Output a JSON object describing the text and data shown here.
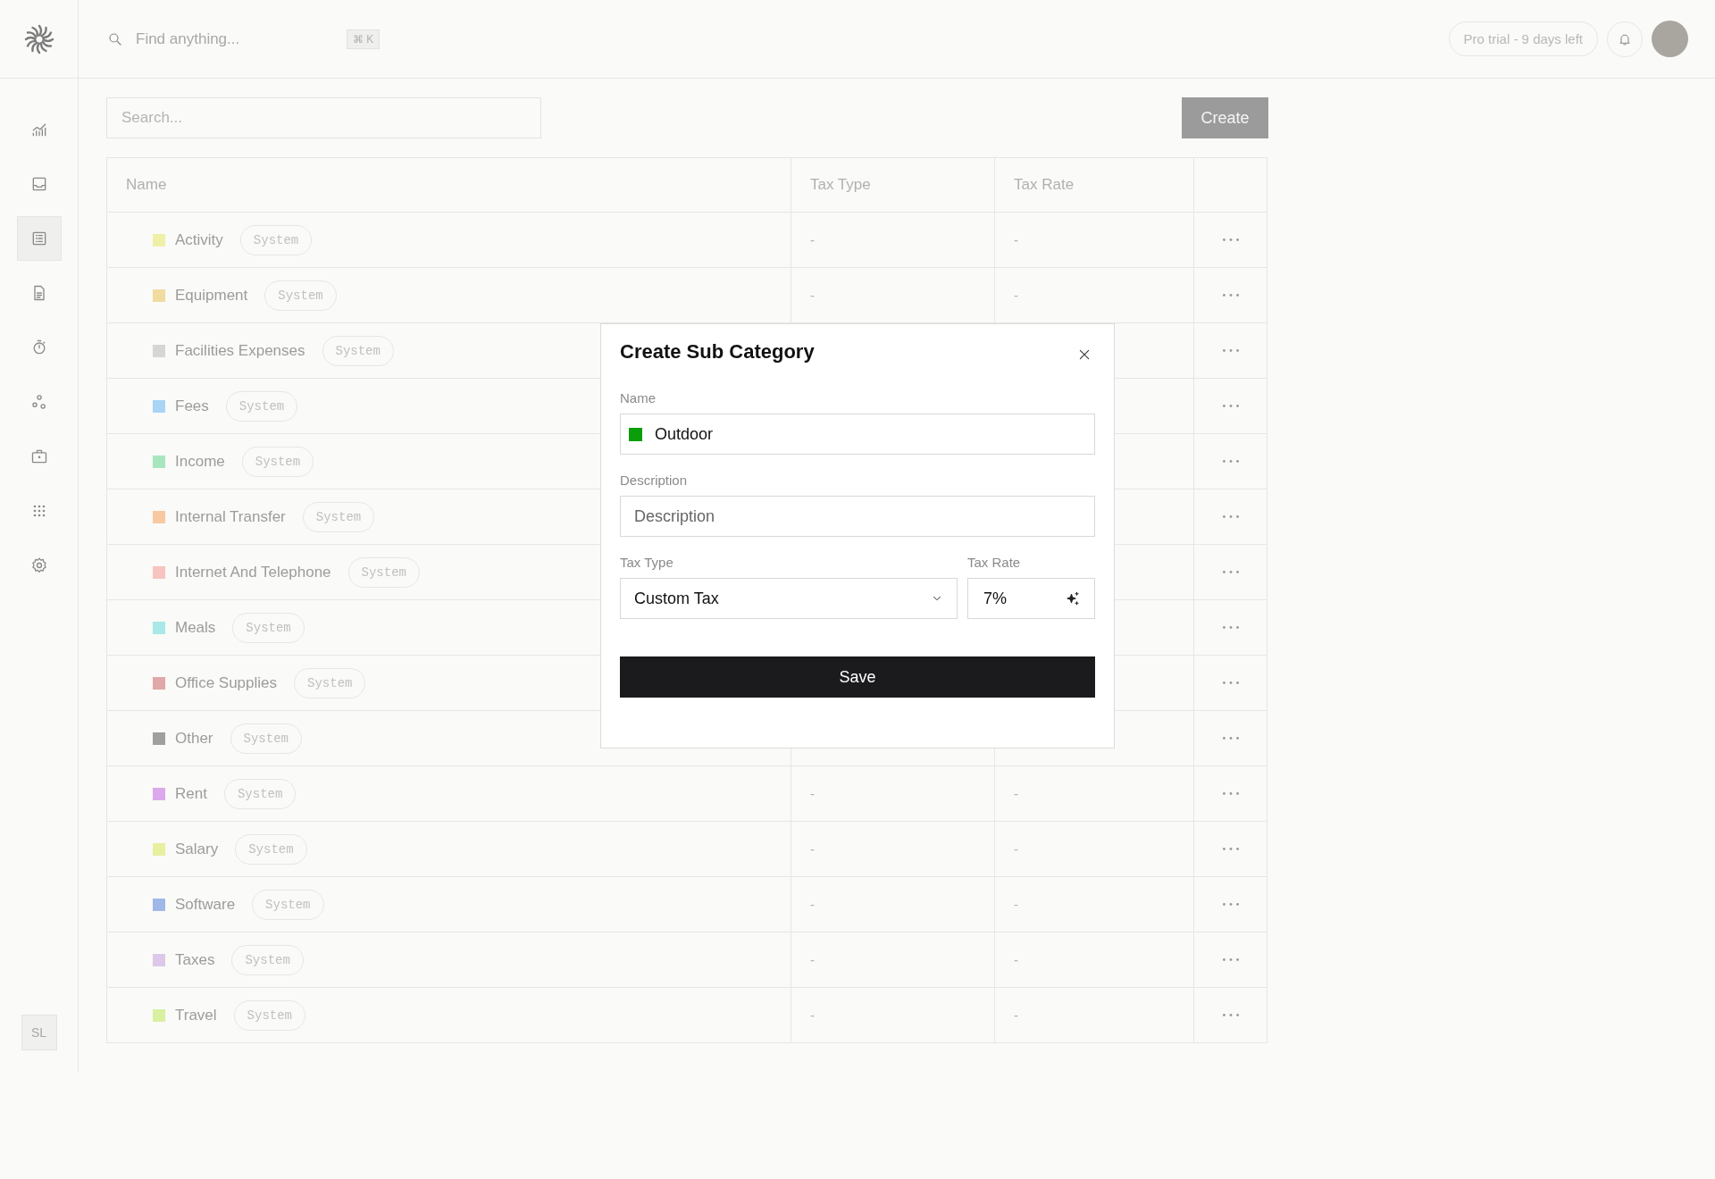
{
  "topbar": {
    "search_placeholder": "Find anything...",
    "shortcut": "⌘ K",
    "trial_badge": "Pro trial - 9 days left"
  },
  "sidebar": {
    "items": [
      {
        "kind": "chart",
        "selected": false
      },
      {
        "kind": "inbox",
        "selected": false
      },
      {
        "kind": "list",
        "selected": true
      },
      {
        "kind": "document",
        "selected": false
      },
      {
        "kind": "timer",
        "selected": false
      },
      {
        "kind": "circles",
        "selected": false
      },
      {
        "kind": "briefcase",
        "selected": false
      },
      {
        "kind": "grid",
        "selected": false
      },
      {
        "kind": "gear",
        "selected": false
      }
    ],
    "user_initials": "SL"
  },
  "toolbar": {
    "search_placeholder": "Search...",
    "create_button": "Create"
  },
  "table": {
    "columns": [
      "Name",
      "Tax Type",
      "Tax Rate"
    ],
    "rows": [
      {
        "name": "Activity",
        "color": "#eef0a8",
        "tag": "System",
        "tax_type": "-",
        "tax_rate": "-"
      },
      {
        "name": "Equipment",
        "color": "#f1dca0",
        "tag": "System",
        "tax_type": "-",
        "tax_rate": "-"
      },
      {
        "name": "Facilities Expenses",
        "color": "#d6d6d6",
        "tag": "System"
      },
      {
        "name": "Fees",
        "color": "#a8d4f5",
        "tag": "System"
      },
      {
        "name": "Income",
        "color": "#a8e6c0",
        "tag": "System"
      },
      {
        "name": "Internal Transfer",
        "color": "#f8c8a0",
        "tag": "System"
      },
      {
        "name": "Internet And Telephone",
        "color": "#f8c4c0",
        "tag": "System"
      },
      {
        "name": "Meals",
        "color": "#a8e8e8",
        "tag": "System"
      },
      {
        "name": "Office Supplies",
        "color": "#e0a8a8",
        "tag": "System"
      },
      {
        "name": "Other",
        "color": "#a0a0a0",
        "tag": "System"
      },
      {
        "name": "Rent",
        "color": "#dca8ec",
        "tag": "System",
        "tax_type": "-",
        "tax_rate": "-"
      },
      {
        "name": "Salary",
        "color": "#e8f0a0",
        "tag": "System",
        "tax_type": "-",
        "tax_rate": "-"
      },
      {
        "name": "Software",
        "color": "#a0b8e8",
        "tag": "System",
        "tax_type": "-",
        "tax_rate": "-"
      },
      {
        "name": "Taxes",
        "color": "#dcc8e8",
        "tag": "System",
        "tax_type": "-",
        "tax_rate": "-"
      },
      {
        "name": "Travel",
        "color": "#d8f0a0",
        "tag": "System",
        "tax_type": "-",
        "tax_rate": "-"
      }
    ]
  },
  "dialog": {
    "title": "Create Sub Category",
    "name_label": "Name",
    "name_value": "Outdoor",
    "description_label": "Description",
    "description_placeholder": "Description",
    "tax_type_label": "Tax Type",
    "tax_type_value": "Custom Tax",
    "tax_rate_label": "Tax Rate",
    "tax_rate_value": "7%",
    "save_button": "Save"
  }
}
